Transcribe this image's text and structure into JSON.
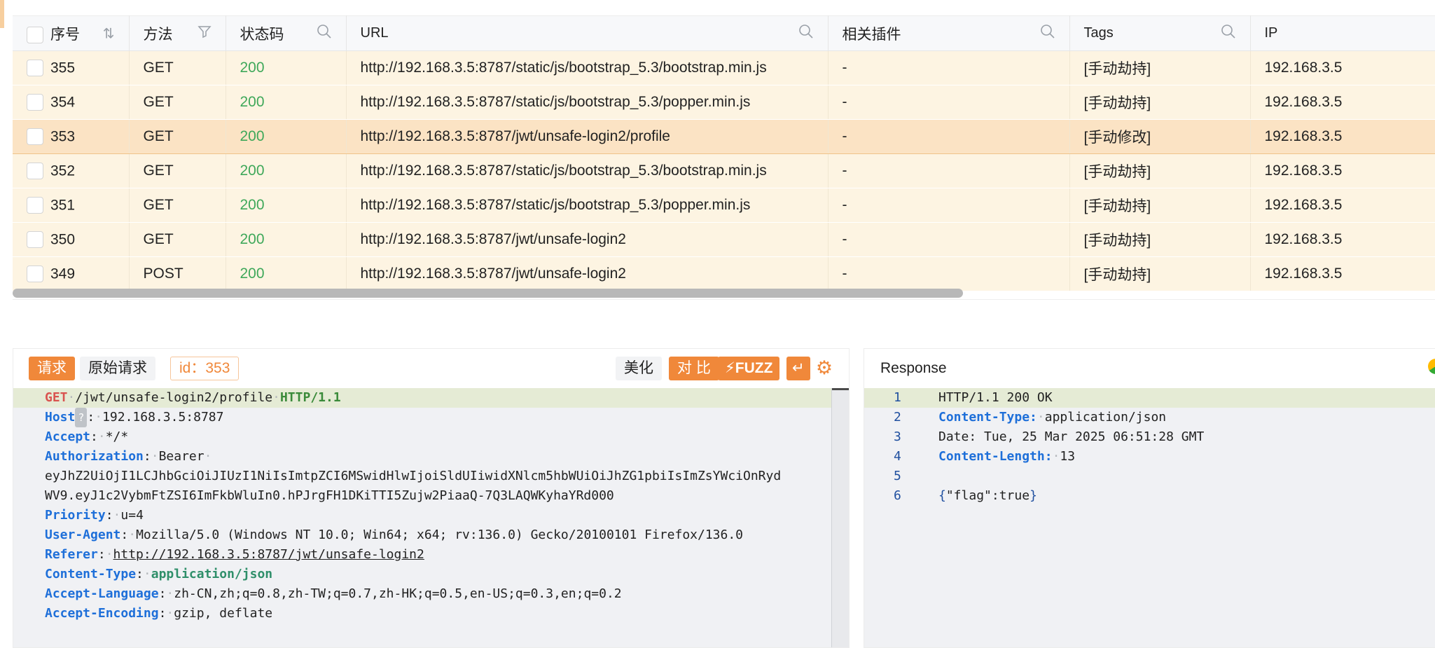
{
  "table": {
    "columns": {
      "index": "序号",
      "method": "方法",
      "status": "状态码",
      "url": "URL",
      "plugin": "相关插件",
      "tags": "Tags",
      "ip": "IP"
    },
    "rows": [
      {
        "id": "355",
        "method": "GET",
        "status": "200",
        "url": "http://192.168.3.5:8787/static/js/bootstrap_5.3/bootstrap.min.js",
        "plugin": "-",
        "tags": "[手动劫持]",
        "ip": "192.168.3.5"
      },
      {
        "id": "354",
        "method": "GET",
        "status": "200",
        "url": "http://192.168.3.5:8787/static/js/bootstrap_5.3/popper.min.js",
        "plugin": "-",
        "tags": "[手动劫持]",
        "ip": "192.168.3.5"
      },
      {
        "id": "353",
        "method": "GET",
        "status": "200",
        "url": "http://192.168.3.5:8787/jwt/unsafe-login2/profile",
        "plugin": "-",
        "tags": "[手动修改]",
        "ip": "192.168.3.5"
      },
      {
        "id": "352",
        "method": "GET",
        "status": "200",
        "url": "http://192.168.3.5:8787/static/js/bootstrap_5.3/bootstrap.min.js",
        "plugin": "-",
        "tags": "[手动劫持]",
        "ip": "192.168.3.5"
      },
      {
        "id": "351",
        "method": "GET",
        "status": "200",
        "url": "http://192.168.3.5:8787/static/js/bootstrap_5.3/popper.min.js",
        "plugin": "-",
        "tags": "[手动劫持]",
        "ip": "192.168.3.5"
      },
      {
        "id": "350",
        "method": "GET",
        "status": "200",
        "url": "http://192.168.3.5:8787/jwt/unsafe-login2",
        "plugin": "-",
        "tags": "[手动劫持]",
        "ip": "192.168.3.5"
      },
      {
        "id": "349",
        "method": "POST",
        "status": "200",
        "url": "http://192.168.3.5:8787/jwt/unsafe-login2",
        "plugin": "-",
        "tags": "[手动劫持]",
        "ip": "192.168.3.5"
      }
    ],
    "selected_row": "353",
    "icons": {
      "sort": "sort-icon",
      "filter": "filter-icon",
      "search": "search-icon"
    }
  },
  "request": {
    "tab_request": "请求",
    "tab_raw": "原始请求",
    "id_badge": "id：353",
    "btn_beautify": "美化",
    "btn_compare": "对 比",
    "btn_fuzz": "FUZZ",
    "help_mark": "?",
    "lines": {
      "method": "GET",
      "path": "/jwt/unsafe-login2/profile",
      "proto": "HTTP/1.1",
      "host_key": "Host",
      "host_val": "192.168.3.5:8787",
      "accept_key": "Accept",
      "accept_val": "*/*",
      "auth_key": "Authorization",
      "auth_val": "Bearer",
      "token_1": "eyJhZ2UiOjI1LCJhbGciOiJIUzI1NiIsImtpZCI6MSwidHlwIjoiSldUIiwidXNlcm5hbWUiOiJhZG1pbiIsImZsYWciOnRyd",
      "token_2": "WV9.eyJ1c2VybmFtZSI6ImFkbWluIn0.hPJrgFH1DKiTTI5Zujw2PiaaQ-7Q3LAQWKyhaYRd000",
      "priority_key": "Priority",
      "priority_val": "u=4",
      "ua_key": "User-Agent",
      "ua_val": "Mozilla/5.0 (Windows NT 10.0; Win64; x64; rv:136.0) Gecko/20100101 Firefox/136.0",
      "referer_key": "Referer",
      "referer_val": "http://192.168.3.5:8787/jwt/unsafe-login2",
      "ct_key": "Content-Type",
      "ct_val": "application/json",
      "al_key": "Accept-Language",
      "al_val": "zh-CN,zh;q=0.8,zh-TW;q=0.7,zh-HK;q=0.5,en-US;q=0.3,en;q=0.2",
      "ae_key": "Accept-Encoding",
      "ae_val": "gzip, deflate"
    }
  },
  "response": {
    "title": "Response",
    "line_numbers": [
      "1",
      "2",
      "3",
      "4",
      "5",
      "6"
    ],
    "status_line": "HTTP/1.1 200 OK",
    "ct_key": "Content-Type:",
    "ct_val": "application/json",
    "date_line": "Date: Tue, 25 Mar 2025 06:51:28 GMT",
    "cl_key": "Content-Length:",
    "cl_val": "13",
    "body_open": "{",
    "body_mid": "\"flag\":true",
    "body_close": "}"
  },
  "colors": {
    "accent": "#f0883a",
    "row_bg": "#fdf4e2",
    "row_selected": "#fbe3c4",
    "status_ok": "#3fa85a",
    "header_key": "#1e6fd9"
  }
}
